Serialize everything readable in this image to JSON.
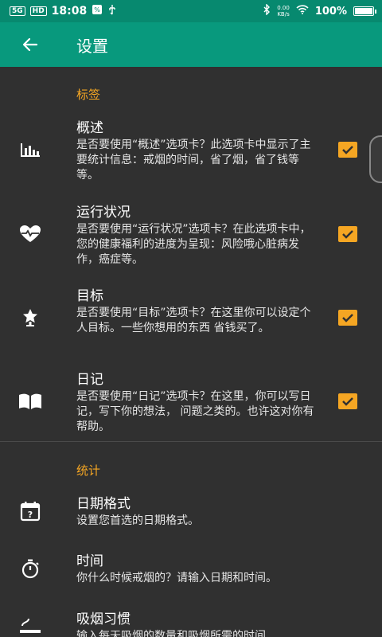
{
  "status": {
    "network": "5G",
    "hd": "HD",
    "time": "18:08",
    "speed_value": "0.00",
    "speed_unit": "KB/s",
    "battery": "100%"
  },
  "appbar": {
    "title": "设置"
  },
  "tabs_section": {
    "header": "标签",
    "items": [
      {
        "title": "概述",
        "subtitle": "是否要使用“概述”选项卡？此选项卡中显示了主要统计信息：戒烟的时间，省了烟，省了钱等等。",
        "checked": true
      },
      {
        "title": "运行状况",
        "subtitle": "是否要使用“运行状况”选项卡？在此选项卡中，您的健康福利的进度为呈现：风险哦心脏病发作，癌症等。",
        "checked": true
      },
      {
        "title": "目标",
        "subtitle": "是否要使用“目标”选项卡？在这里你可以设定个人目标。一些你想用的东西 省钱买了。",
        "checked": true
      },
      {
        "title": "日记",
        "subtitle": "是否要使用“日记”选项卡？在这里，你可以写日记，写下你的想法， 问题之类的。也许这对你有帮助。",
        "checked": true
      }
    ]
  },
  "stats_section": {
    "header": "统计",
    "items": [
      {
        "title": "日期格式",
        "subtitle": "设置您首选的日期格式。"
      },
      {
        "title": "时间",
        "subtitle": "你什么时候戒烟的？请输入日期和时间。"
      },
      {
        "title": "吸烟习惯",
        "subtitle": "输入每天吸烟的数量和吸烟所需的时间"
      }
    ]
  }
}
